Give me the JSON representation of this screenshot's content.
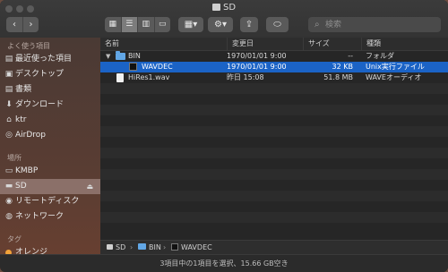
{
  "window": {
    "title": "SD"
  },
  "toolbar": {
    "back_icon": "chevron-left-icon",
    "forward_icon": "chevron-right-icon",
    "view_modes": [
      "icon-view",
      "list-view",
      "column-view",
      "gallery-view"
    ],
    "active_view_index": 1,
    "arrange_icon": "grid-arrange-icon",
    "action_icon": "gear-icon",
    "share_icon": "share-icon",
    "tag_icon": "tag-icon",
    "search": {
      "placeholder": "検索"
    }
  },
  "sidebar": {
    "sections": [
      {
        "title": "よく使う項目",
        "items": [
          {
            "label": "最近使った項目",
            "icon": "recent-icon"
          },
          {
            "label": "デスクトップ",
            "icon": "desktop-icon"
          },
          {
            "label": "書類",
            "icon": "documents-icon"
          },
          {
            "label": "ダウンロード",
            "icon": "downloads-icon"
          },
          {
            "label": "ktr",
            "icon": "home-icon"
          },
          {
            "label": "AirDrop",
            "icon": "airdrop-icon"
          }
        ]
      },
      {
        "title": "場所",
        "items": [
          {
            "label": "KMBP",
            "icon": "laptop-icon"
          },
          {
            "label": "SD",
            "icon": "drive-icon",
            "selected": true,
            "eject": true
          },
          {
            "label": "リモートディスク",
            "icon": "disc-icon"
          },
          {
            "label": "ネットワーク",
            "icon": "network-icon"
          }
        ]
      },
      {
        "title": "タグ",
        "items": [
          {
            "label": "オレンジ",
            "icon": "orange-tag-dot",
            "color": "#f2a33a"
          }
        ]
      }
    ]
  },
  "list": {
    "columns": [
      "名前",
      "変更日",
      "サイズ",
      "種類"
    ],
    "rows": [
      {
        "name": "BIN",
        "date": "1970/01/01 9:00",
        "size": "--",
        "kind": "フォルダ",
        "type": "folder",
        "expanded": true,
        "indent": 0
      },
      {
        "name": "WAVDEC",
        "date": "1970/01/01 9:00",
        "size": "32 KB",
        "kind": "Unix実行ファイル",
        "type": "exec",
        "indent": 1,
        "selected": true
      },
      {
        "name": "HiRes1.wav",
        "date": "昨日 15:08",
        "size": "51.8 MB",
        "kind": "WAVEオーディオ",
        "type": "doc",
        "indent": 0
      }
    ]
  },
  "pathbar": {
    "items": [
      "SD",
      "BIN",
      "WAVDEC"
    ]
  },
  "status": {
    "text": "3項目中の1項目を選択、15.66 GB空き"
  },
  "colors": {
    "selection": "#1b63c6",
    "folder": "#62a7e6",
    "sidebar_selected": "#8b7069"
  }
}
